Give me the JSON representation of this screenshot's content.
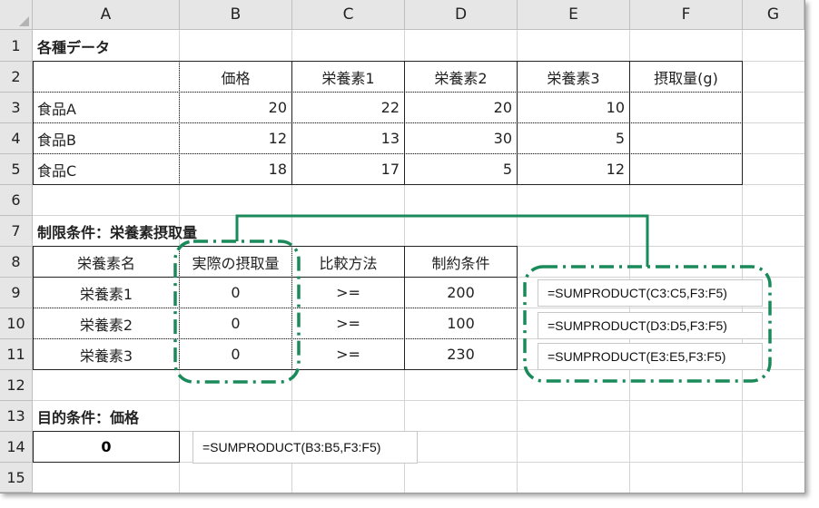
{
  "columns": [
    "A",
    "B",
    "C",
    "D",
    "E",
    "F",
    "G"
  ],
  "rows": [
    "1",
    "2",
    "3",
    "4",
    "5",
    "6",
    "7",
    "8",
    "9",
    "10",
    "11",
    "12",
    "13",
    "14",
    "15"
  ],
  "section1": {
    "title": "各種データ",
    "headers": [
      "価格",
      "栄養素1",
      "栄養素2",
      "栄養素3",
      "摂取量(g)"
    ],
    "rows": [
      {
        "name": "食品A",
        "values": [
          "20",
          "22",
          "20",
          "10",
          ""
        ]
      },
      {
        "name": "食品B",
        "values": [
          "12",
          "13",
          "30",
          "5",
          ""
        ]
      },
      {
        "name": "食品C",
        "values": [
          "18",
          "17",
          "5",
          "12",
          ""
        ]
      }
    ]
  },
  "section2": {
    "title": "制限条件：栄養素摂取量",
    "headers": [
      "栄養素名",
      "実際の摂取量",
      "比較方法",
      "制約条件"
    ],
    "rows": [
      {
        "name": "栄養素1",
        "actual": "0",
        "op": ">=",
        "limit": "200"
      },
      {
        "name": "栄養素2",
        "actual": "0",
        "op": ">=",
        "limit": "100"
      },
      {
        "name": "栄養素3",
        "actual": "0",
        "op": ">=",
        "limit": "230"
      }
    ],
    "formulas": [
      "=SUMPRODUCT(C3:C5,F3:F5)",
      "=SUMPRODUCT(D3:D5,F3:F5)",
      "=SUMPRODUCT(E3:E5,F3:F5)"
    ]
  },
  "section3": {
    "title": "目的条件：価格",
    "value": "0",
    "formula": "=SUMPRODUCT(B3:B5,F3:F5)"
  },
  "colors": {
    "annotation": "#1a8a5a",
    "header_bg": "#e6e6e6",
    "gridline": "#d4d4d4"
  }
}
